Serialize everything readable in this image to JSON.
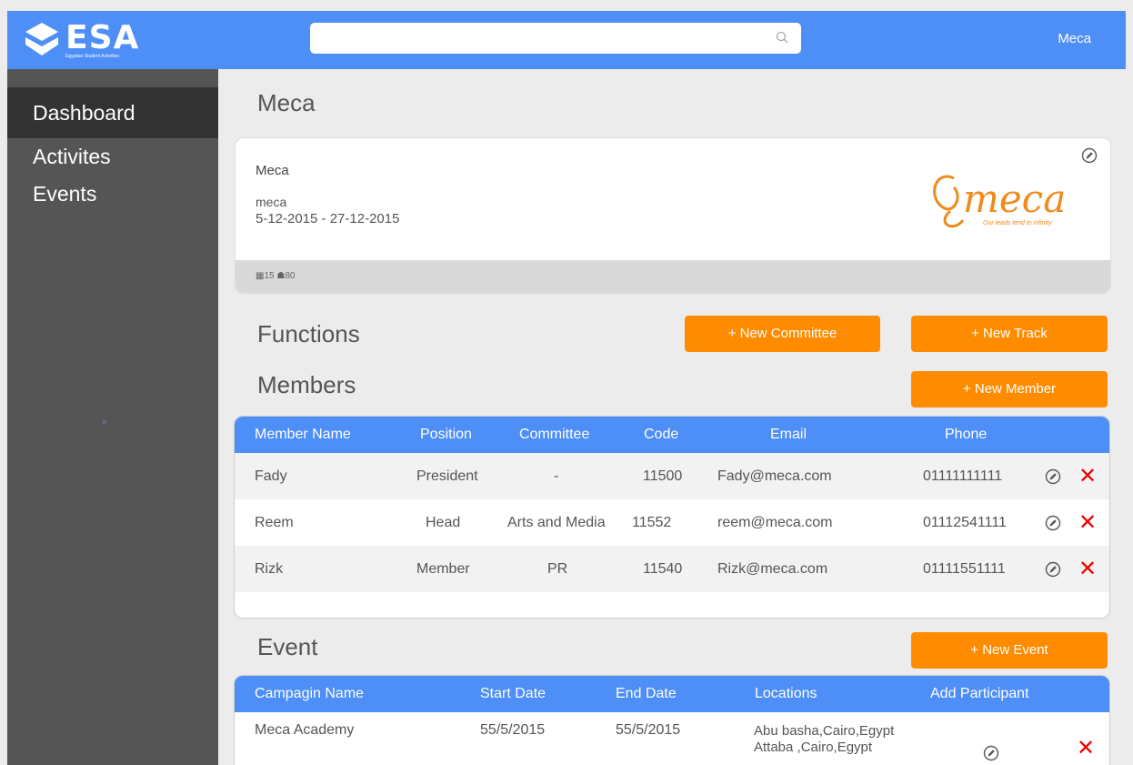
{
  "app": {
    "logo_text": "ESA",
    "logo_sub": "Egyptian Student Activities",
    "user": "Meca"
  },
  "search": {
    "placeholder": "",
    "value": ""
  },
  "sidebar": {
    "items": [
      {
        "label": "Dashboard",
        "active": true
      },
      {
        "label": "Activites"
      },
      {
        "label": "Events"
      }
    ],
    "close": "×"
  },
  "page": {
    "title": "Meca"
  },
  "card": {
    "name": "Meca",
    "slug": "meca",
    "dates": "5-12-2015 -  27-12-2015",
    "stat_calendar": "15",
    "stat_people": "80",
    "logo_text": "meca",
    "logo_tagline": "Our leads tend to infinity"
  },
  "functions": {
    "title": "Functions",
    "new_committee": "+ New Committee",
    "new_track": "+ New Track"
  },
  "members": {
    "title": "Members",
    "new_member": "+ New Member",
    "columns": [
      "Member Name",
      "Position",
      "Committee",
      "Code",
      "Email",
      "Phone"
    ],
    "rows": [
      {
        "name": "Fady",
        "position": "President",
        "committee": "-",
        "code": "11500",
        "email": "Fady@meca.com",
        "phone": "01111111111"
      },
      {
        "name": "Reem",
        "position": "Head",
        "committee": "Arts and Media",
        "code": "11552",
        "email": "reem@meca.com",
        "phone": "01112541111"
      },
      {
        "name": "Rizk",
        "position": "Member",
        "committee": "PR",
        "code": "11540",
        "email": "Rizk@meca.com",
        "phone": "01111551111"
      }
    ]
  },
  "event": {
    "title": "Event",
    "new_event": "+ New Event",
    "columns": [
      "Campagin Name",
      "Start Date",
      "End Date",
      "Locations",
      "Add Participant"
    ],
    "rows": [
      {
        "name": "Meca Academy",
        "start": "55/5/2015",
        "end": "55/5/2015",
        "location1": "Abu basha,Cairo,Egypt",
        "location2": "Attaba ,Cairo,Egypt"
      }
    ]
  },
  "colors": {
    "primary": "#4e8ef7",
    "accent": "#ff8c00",
    "sidebar": "#555555",
    "delete": "#ee0000"
  },
  "icons": {
    "edit": "edit-icon",
    "delete": "delete-icon",
    "search": "search-icon",
    "calendar": "calendar-icon",
    "people": "people-icon"
  }
}
